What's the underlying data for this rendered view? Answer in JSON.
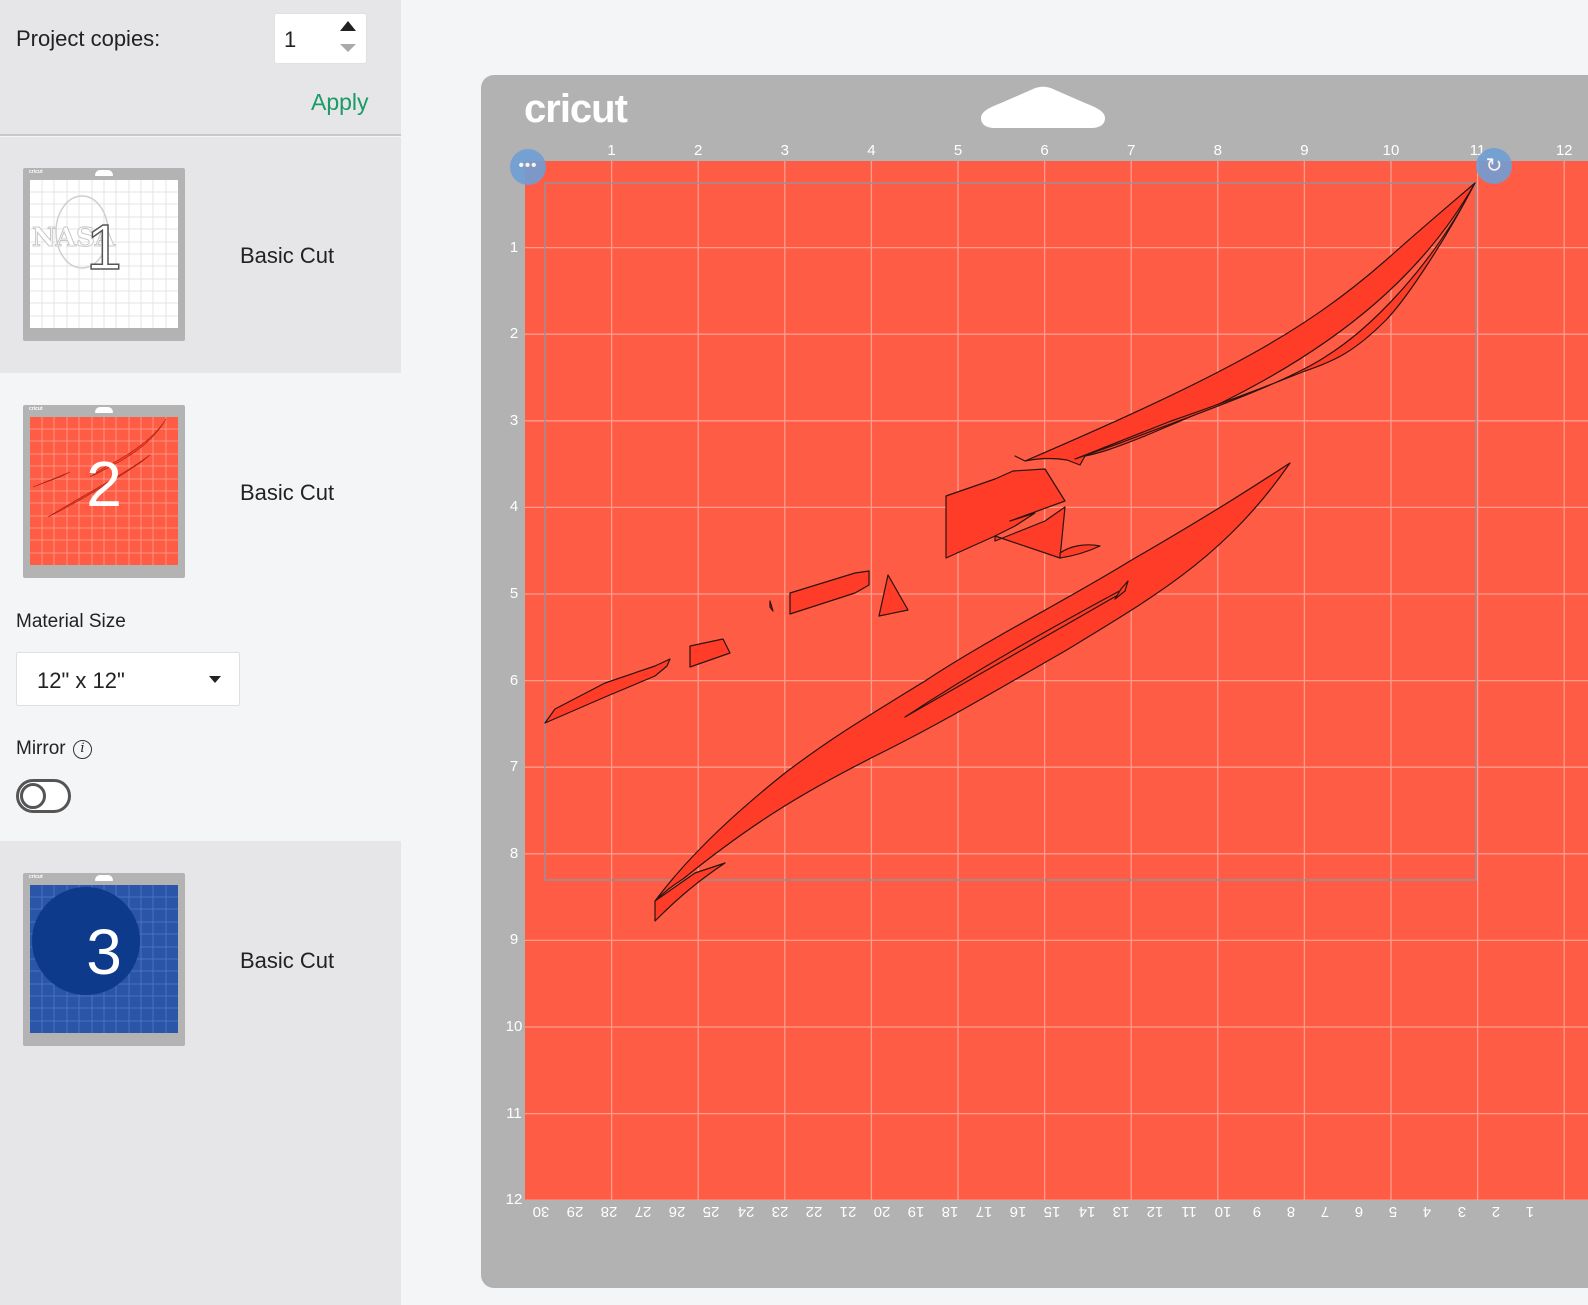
{
  "copies": {
    "label": "Project copies:",
    "value": "1",
    "apply_label": "Apply"
  },
  "mats": [
    {
      "number": "1",
      "label": "Basic Cut",
      "color": "#ffffff",
      "thumb_text": "NASA"
    },
    {
      "number": "2",
      "label": "Basic Cut",
      "color": "#ff5c45"
    },
    {
      "number": "3",
      "label": "Basic Cut",
      "color": "#2a55a8"
    }
  ],
  "material": {
    "label": "Material Size",
    "value": "12\" x 12\""
  },
  "mirror": {
    "label": "Mirror",
    "info_glyph": "i",
    "enabled": false
  },
  "mat_view": {
    "brand": "cricut",
    "mat_color": "#ff5c45",
    "shape_color": "#ff3c28",
    "ruler_top": [
      "1",
      "2",
      "3",
      "4",
      "5",
      "6",
      "7",
      "8",
      "9",
      "10",
      "11",
      "12"
    ],
    "ruler_left": [
      "1",
      "2",
      "3",
      "4",
      "5",
      "6",
      "7",
      "8",
      "9",
      "10",
      "11",
      "12"
    ],
    "ruler_bottom": [
      "30",
      "29",
      "28",
      "27",
      "26",
      "25",
      "24",
      "23",
      "22",
      "21",
      "20",
      "19",
      "18",
      "17",
      "16",
      "15",
      "14",
      "13",
      "12",
      "11",
      "10",
      "9",
      "8",
      "7",
      "6",
      "5",
      "4",
      "3",
      "2",
      "1"
    ],
    "more_glyph": "•••",
    "rotate_glyph": "↻"
  }
}
